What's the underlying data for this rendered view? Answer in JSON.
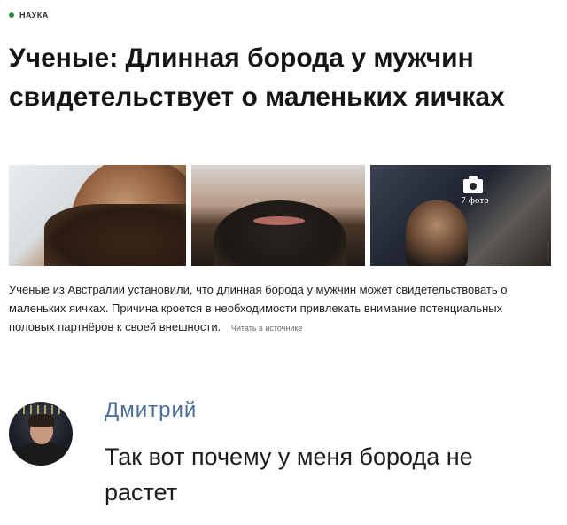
{
  "article": {
    "section": "НАУКА",
    "headline": "Ученые: Длинная борода у мужчин свидетельствует о маленьких яичках",
    "photo_count": "7 фото",
    "summary": "Учёные из Австралии установили, что длинная борода у мужчин может свидетельствовать о маленьких яичках. Причина кроется в необходимости привлекать внимание потенциальных половых партнёров к своей внешности.",
    "source_link": "Читать в источнике",
    "accent_color": "#2c8c3a"
  },
  "comment": {
    "author": "Дмитрий",
    "text": "Так вот почему у меня борода не растет",
    "name_color": "#4a6f9a"
  }
}
